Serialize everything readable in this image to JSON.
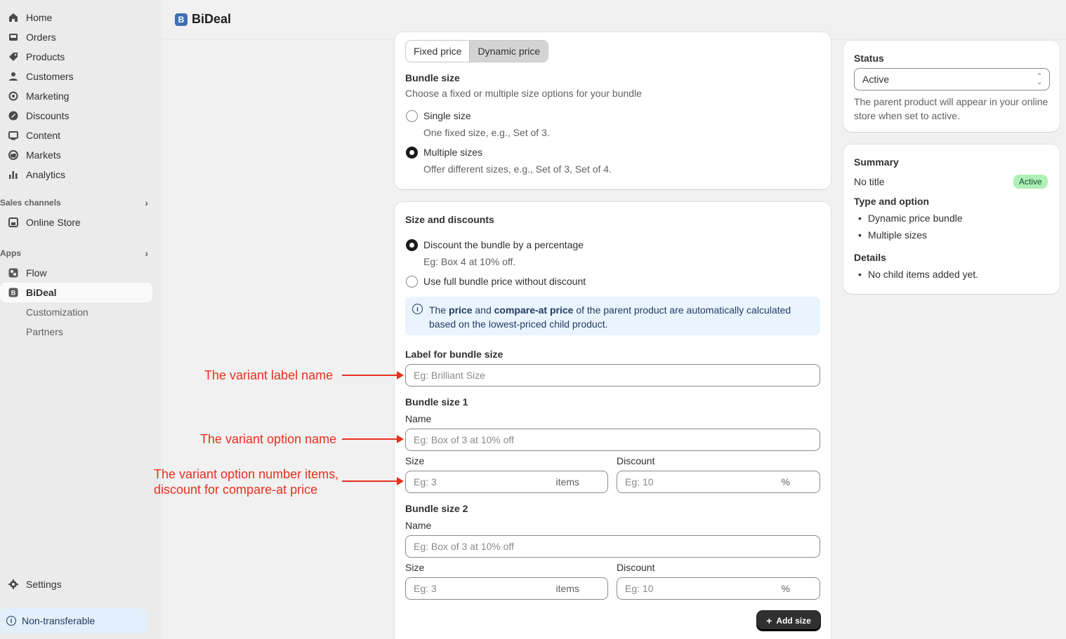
{
  "sidebar": {
    "items": [
      {
        "label": "Home",
        "icon": "home-icon"
      },
      {
        "label": "Orders",
        "icon": "inbox-icon"
      },
      {
        "label": "Products",
        "icon": "tag-icon"
      },
      {
        "label": "Customers",
        "icon": "person-icon"
      },
      {
        "label": "Marketing",
        "icon": "target-icon"
      },
      {
        "label": "Discounts",
        "icon": "discount-icon"
      },
      {
        "label": "Content",
        "icon": "content-icon"
      },
      {
        "label": "Markets",
        "icon": "globe-icon"
      },
      {
        "label": "Analytics",
        "icon": "bar-chart-icon"
      }
    ],
    "sales_channels_label": "Sales channels",
    "online_store": "Online Store",
    "apps_label": "Apps",
    "flow": "Flow",
    "bideal": "BiDeal",
    "customization": "Customization",
    "partners": "Partners",
    "settings": "Settings",
    "non_transferable": "Non-transferable"
  },
  "topbar": {
    "app_name": "BiDeal",
    "logo_letter": "B"
  },
  "pricing": {
    "fixed": "Fixed price",
    "dynamic": "Dynamic price",
    "selected": "Dynamic price"
  },
  "bundle_size": {
    "title": "Bundle size",
    "description": "Choose a fixed or multiple size options for your bundle",
    "single_label": "Single size",
    "single_help": "One fixed size, e.g., Set of 3.",
    "multiple_label": "Multiple sizes",
    "multiple_help": "Offer different sizes, e.g., Set of 3, Set of 4.",
    "selected": "Multiple sizes"
  },
  "size_discounts": {
    "title": "Size and discounts",
    "percent_label": "Discount the bundle by a percentage",
    "percent_help": "Eg: Box 4 at 10% off.",
    "full_label": "Use full bundle price without discount",
    "selected": "Discount the bundle by a percentage",
    "banner_pre": "The ",
    "banner_b1": "price",
    "banner_mid": " and ",
    "banner_b2": "compare-at price",
    "banner_post": " of the parent product are automatically calculated based on the lowest-priced child product.",
    "label_title": "Label for bundle size",
    "label_placeholder": "Eg: Brilliant Size",
    "sizes": [
      {
        "title": "Bundle size 1",
        "name_label": "Name",
        "name_placeholder": "Eg: Box of 3 at 10% off",
        "size_label": "Size",
        "size_placeholder": "Eg: 3",
        "size_suffix": "items",
        "discount_label": "Discount",
        "discount_placeholder": "Eg: 10",
        "discount_suffix": "%"
      },
      {
        "title": "Bundle size 2",
        "name_label": "Name",
        "name_placeholder": "Eg: Box of 3 at 10% off",
        "size_label": "Size",
        "size_placeholder": "Eg: 3",
        "size_suffix": "items",
        "discount_label": "Discount",
        "discount_placeholder": "Eg: 10",
        "discount_suffix": "%"
      }
    ],
    "add_size": "Add size",
    "add_size_icon": "+"
  },
  "status": {
    "title": "Status",
    "value": "Active",
    "help": "The parent product will appear in your online store when set to active."
  },
  "summary": {
    "title": "Summary",
    "name": "No title",
    "badge": "Active",
    "type_title": "Type and option",
    "type_items": [
      "Dynamic price bundle",
      "Multiple sizes"
    ],
    "details_title": "Details",
    "details_items": [
      "No child items added yet."
    ]
  },
  "annotations": {
    "label_name": "The variant label name",
    "option_name": "The variant option name",
    "option_items_line1": "The variant option number items,",
    "option_items_line2": "discount for compare-at price",
    "color": "#e8301c"
  }
}
